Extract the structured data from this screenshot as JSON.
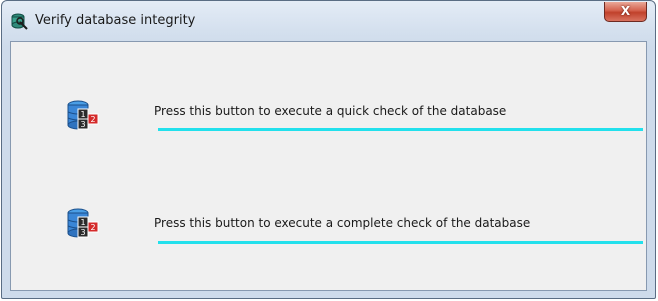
{
  "window": {
    "title": "Verify database integrity",
    "close_label": "X"
  },
  "checks": [
    {
      "description": "Press this button to execute a quick check of the database",
      "progress": 1.0,
      "icon": "database-check-icon"
    },
    {
      "description": "Press this button to execute a complete check of the database",
      "progress": 1.0,
      "icon": "database-check-icon"
    }
  ],
  "colors": {
    "progress_bar": "#22e0ec",
    "close_button": "#c7472f",
    "dialog_background": "#f0f0f0"
  }
}
